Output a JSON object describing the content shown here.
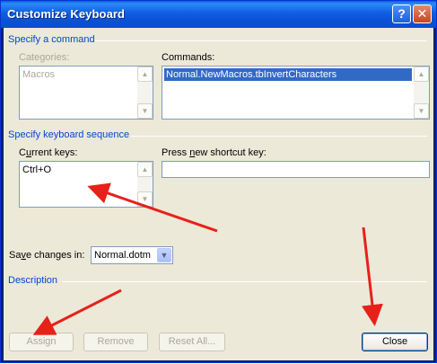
{
  "window": {
    "title": "Customize Keyboard",
    "help_glyph": "?",
    "close_glyph": "✕"
  },
  "specify_command": {
    "heading": "Specify a command",
    "categories_label": "Categories:",
    "categories_items": [
      "Macros"
    ],
    "commands_label": "Commands:",
    "commands_items": [
      "Normal.NewMacros.tbInvertCharacters"
    ]
  },
  "keyboard_sequence": {
    "heading": "Specify keyboard sequence",
    "current_keys_label_pre": "C",
    "current_keys_label_u": "u",
    "current_keys_label_post": "rrent keys:",
    "current_keys_items": [
      "Ctrl+O"
    ],
    "new_key_label_pre": "Press ",
    "new_key_label_u": "n",
    "new_key_label_post": "ew shortcut key:",
    "new_key_value": ""
  },
  "save_changes": {
    "label_pre": "Sa",
    "label_u": "v",
    "label_post": "e changes in:",
    "value": "Normal.dotm"
  },
  "description": {
    "heading": "Description"
  },
  "buttons": {
    "assign": "Assign",
    "remove": "Remove",
    "reset_all": "Reset All...",
    "close": "Close"
  },
  "colors": {
    "title_bar": "#0b53d4",
    "section_heading": "#0046d5",
    "annotation_arrow": "#e8201a",
    "selection": "#316ac5"
  }
}
